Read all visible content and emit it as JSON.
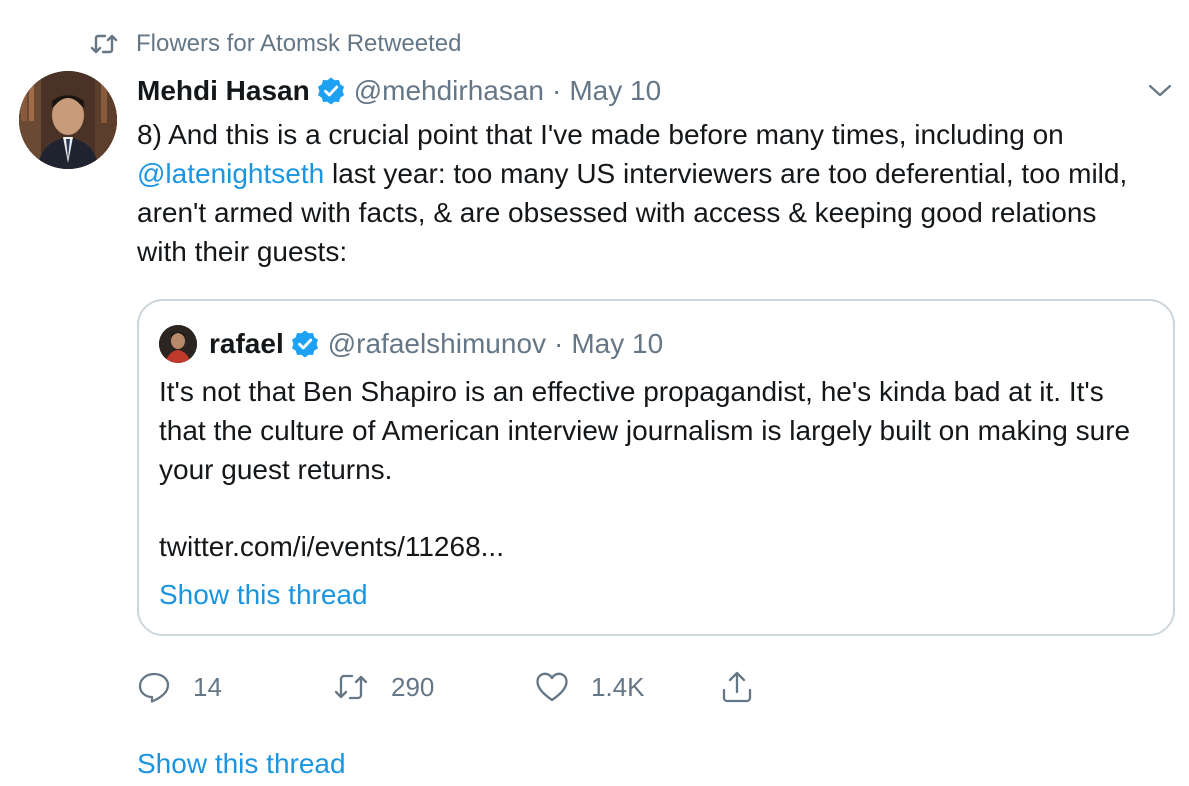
{
  "retweet_context": {
    "text": "Flowers for Atomsk Retweeted",
    "icon": "retweet-icon"
  },
  "tweet": {
    "author_name": "Mehdi Hasan",
    "handle": "@mehdirhasan",
    "separator": "·",
    "date": "May 10",
    "text_before_mention": "8) And this is a crucial point that I've made before many times, including on ",
    "mention": "@latenightseth",
    "text_after_mention": " last year: too many US interviewers are too deferential, too mild, aren't armed with facts, & are obsessed with access & keeping good relations with their guests:"
  },
  "quote": {
    "author_name": "rafael",
    "handle": "@rafaelshimunov",
    "separator": "·",
    "date": "May 10",
    "text": "It's not that Ben Shapiro is an effective propagandist, he's kinda bad at it. It's that the culture of American interview journalism is largely built on making sure your guest returns.",
    "link": "twitter.com/i/events/11268...",
    "show_thread": "Show this thread"
  },
  "actions": {
    "replies": "14",
    "retweets": "290",
    "likes": "1.4K"
  },
  "show_thread": "Show this thread",
  "colors": {
    "link_blue": "#1b95e0",
    "verified_blue": "#1da1f2",
    "secondary_gray": "#657786",
    "border": "#ccd6dd"
  }
}
